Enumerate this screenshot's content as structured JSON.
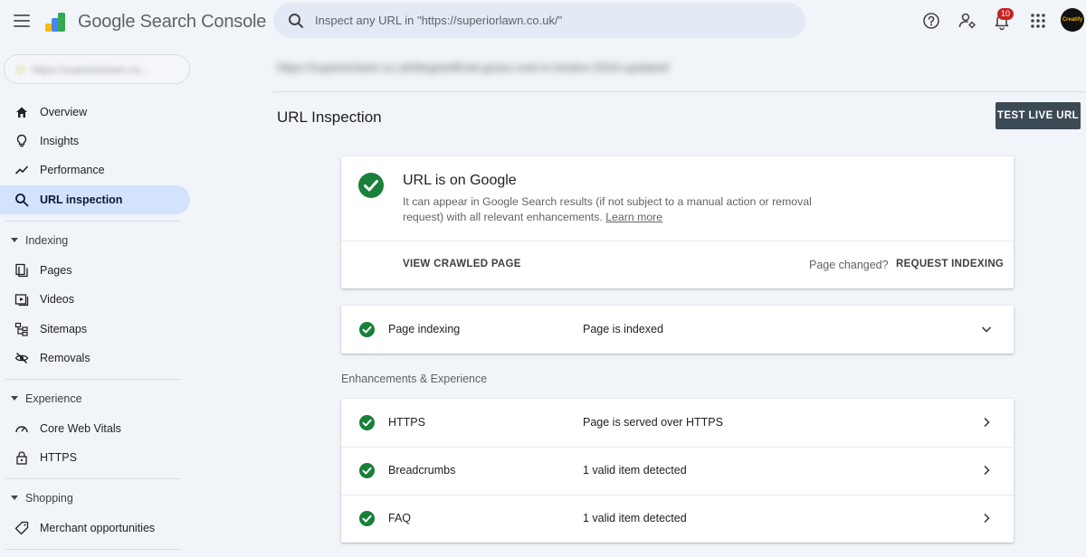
{
  "header": {
    "app_name": "Google Search Console",
    "search_placeholder": "Inspect any URL in \"https://superiorlawn.co.uk/\"",
    "notification_count": "10",
    "avatar_text": "Creatify"
  },
  "sidebar": {
    "property_label": "https://superiorlawn.co...",
    "items": {
      "overview": "Overview",
      "insights": "Insights",
      "performance": "Performance",
      "url_inspection": "URL inspection",
      "pages": "Pages",
      "videos": "Videos",
      "sitemaps": "Sitemaps",
      "removals": "Removals",
      "core_web_vitals": "Core Web Vitals",
      "https": "HTTPS",
      "merchant": "Merchant opportunities"
    },
    "sections": {
      "indexing": "Indexing",
      "experience": "Experience",
      "shopping": "Shopping"
    }
  },
  "main": {
    "inspected_url": "https://superiorlawn.co.uk/blog/artificial-grass-cost-in-london-2024-updated/",
    "page_title": "URL Inspection",
    "test_live_url": "TEST LIVE URL",
    "status": {
      "title": "URL is on Google",
      "description": "It can appear in Google Search results (if not subject to a manual action or removal request) with all relevant enhancements.",
      "learn_more": "Learn more",
      "view_crawled": "VIEW CRAWLED PAGE",
      "page_changed": "Page changed?",
      "request_indexing": "REQUEST INDEXING"
    },
    "indexing_row": {
      "name": "Page indexing",
      "value": "Page is indexed"
    },
    "enhancements_label": "Enhancements & Experience",
    "enhancements": [
      {
        "name": "HTTPS",
        "value": "Page is served over HTTPS"
      },
      {
        "name": "Breadcrumbs",
        "value": "1 valid item detected"
      },
      {
        "name": "FAQ",
        "value": "1 valid item detected"
      }
    ]
  },
  "colors": {
    "accent": "#d3e3fd",
    "success": "#188038",
    "button_dark": "#3c4a55",
    "badge": "#c5221f"
  }
}
